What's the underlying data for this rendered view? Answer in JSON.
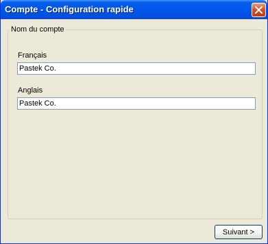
{
  "window": {
    "title": "Compte - Configuration rapide"
  },
  "group": {
    "legend": "Nom du compte",
    "french": {
      "label": "Français",
      "value": "Pastek Co."
    },
    "english": {
      "label": "Anglais",
      "value": "Pastek Co."
    }
  },
  "buttons": {
    "next_label": "Suivant >"
  },
  "icons": {
    "close": "close-icon"
  },
  "colors": {
    "titlebar": "#0054e3",
    "close": "#d4532a",
    "background": "#ece9d8",
    "input_border": "#7f9db9"
  }
}
